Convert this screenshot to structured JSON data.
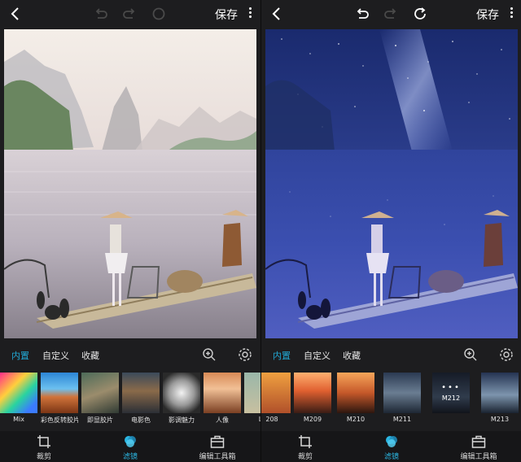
{
  "left": {
    "topbar": {
      "save_label": "保存"
    },
    "filter_tabs": [
      {
        "label": "内置",
        "active": true
      },
      {
        "label": "自定义",
        "active": false
      },
      {
        "label": "收藏",
        "active": false
      }
    ],
    "filters": [
      {
        "label": "Mix",
        "bg": "linear-gradient(135deg,#ff2d8a,#ffcf3c 35%,#29d3a0 60%,#3b7bff 85%)"
      },
      {
        "label": "彩色反转胶片",
        "bg": "linear-gradient(180deg,#2c86d6,#6cc0ef 40%,#d0733a 60%,#7b3515)"
      },
      {
        "label": "即显胶片",
        "bg": "linear-gradient(160deg,#4d6b59,#9b8c6c 50%,#2f3a33)"
      },
      {
        "label": "电影色",
        "bg": "linear-gradient(180deg,#3b4a5a,#8a6a4a 45%,#2b2f36)"
      },
      {
        "label": "影调魅力",
        "bg": "radial-gradient(circle at 50% 50%,#f2f2f2,#9a9a9a 45%,#2a2a2a 80%)"
      },
      {
        "label": "人像",
        "bg": "linear-gradient(180deg,#d88a56,#f1c096 40%,#7a3f22)"
      },
      {
        "label": "LO",
        "bg": "linear-gradient(180deg,#9ab7a9,#c8c0a0)"
      }
    ],
    "bottom_nav": [
      {
        "label": "裁剪",
        "active": false
      },
      {
        "label": "滤镜",
        "active": true
      },
      {
        "label": "编辑工具箱",
        "active": false
      }
    ]
  },
  "right": {
    "topbar": {
      "save_label": "保存"
    },
    "filter_tabs": [
      {
        "label": "内置",
        "active": true
      },
      {
        "label": "自定义",
        "active": false
      },
      {
        "label": "收藏",
        "active": false
      }
    ],
    "filters": [
      {
        "label": "208",
        "bg": "linear-gradient(180deg,#f0a040,#b0502a)"
      },
      {
        "label": "M209",
        "bg": "linear-gradient(180deg,#ffb070,#e06030 45%,#3a1c15)"
      },
      {
        "label": "M210",
        "bg": "linear-gradient(180deg,#f7a65a,#c5582a 50%,#2d160f)"
      },
      {
        "label": "M211",
        "bg": "linear-gradient(180deg,#2b3a52,#6a7d92 50%,#1d2633)"
      },
      {
        "label": "M212",
        "bg": "linear-gradient(180deg,#222a3c,#4a5c75 60%,#1a1f2a)",
        "selected": true
      },
      {
        "label": "M213",
        "bg": "linear-gradient(180deg,#253452,#7d94ad 55%,#1a2330)"
      }
    ],
    "bottom_nav": [
      {
        "label": "裁剪",
        "active": false
      },
      {
        "label": "滤镜",
        "active": true
      },
      {
        "label": "编辑工具箱",
        "active": false
      }
    ]
  }
}
